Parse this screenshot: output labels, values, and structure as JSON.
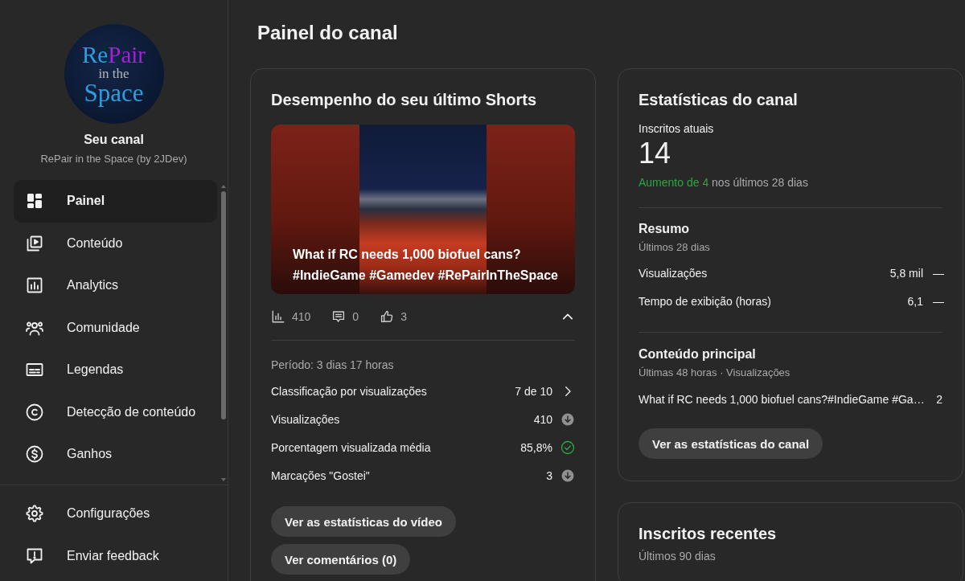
{
  "page_title": "Painel do canal",
  "sidebar": {
    "logo": {
      "line_1": [
        "Re",
        "Pair"
      ],
      "line_2": "in the",
      "line_3": "Space"
    },
    "channel_label": "Seu canal",
    "channel_name": "RePair in the Space (by 2JDev)",
    "nav_items": [
      {
        "label": "Painel",
        "selected": true
      },
      {
        "label": "Conteúdo",
        "selected": false
      },
      {
        "label": "Analytics",
        "selected": false
      },
      {
        "label": "Comunidade",
        "selected": false
      },
      {
        "label": "Legendas",
        "selected": false
      },
      {
        "label": "Detecção de conteúdo",
        "selected": false
      },
      {
        "label": "Ganhos",
        "selected": false
      }
    ],
    "footer_items": [
      {
        "label": "Configurações"
      },
      {
        "label": "Enviar feedback"
      }
    ]
  },
  "latest_shorts_card": {
    "title": "Desempenho do seu último Shorts",
    "video_title": "What if RC needs 1,000 biofuel cans? #IndieGame #Gamedev #RePairInTheSpace",
    "views": "410",
    "comments": "0",
    "likes": "3",
    "expanded": true,
    "period": "Período: 3 dias 17 horas",
    "metrics": [
      {
        "label": "Classificação por visualizações",
        "value": "7 de 10",
        "kind": "link"
      },
      {
        "label": "Visualizações",
        "value": "410",
        "kind": "below_typical"
      },
      {
        "label": "Porcentagem visualizada média",
        "value": "85,8%",
        "kind": "above_typical"
      },
      {
        "label": "Marcações \"Gostei\"",
        "value": "3",
        "kind": "below_typical"
      }
    ],
    "buttons": [
      "Ver as estatísticas do vídeo",
      "Ver comentários (0)"
    ]
  },
  "channel_stats_card": {
    "title": "Estatísticas do canal",
    "subscribers_label": "Inscritos atuais",
    "subscribers": "14",
    "growth_highlight": "Aumento de 4",
    "growth_rest": "nos últimos 28 dias",
    "summary": {
      "title": "Resumo",
      "period": "Últimos 28 dias",
      "rows": [
        {
          "label": "Visualizações",
          "value": "5,8 mil",
          "trend": "—"
        },
        {
          "label": "Tempo de exibição (horas)",
          "value": "6,1",
          "trend": "—"
        }
      ]
    },
    "top_content": {
      "title": "Conteúdo principal",
      "subtitle": "Últimas 48 horas · Visualizações",
      "rows": [
        {
          "title": "What if RC needs 1,000 biofuel cans?#IndieGame #Ga…",
          "views": "2"
        }
      ]
    },
    "button": "Ver as estatísticas do canal"
  },
  "recent_subscribers_card": {
    "title": "Inscritos recentes",
    "period": "Últimos 90 dias"
  }
}
